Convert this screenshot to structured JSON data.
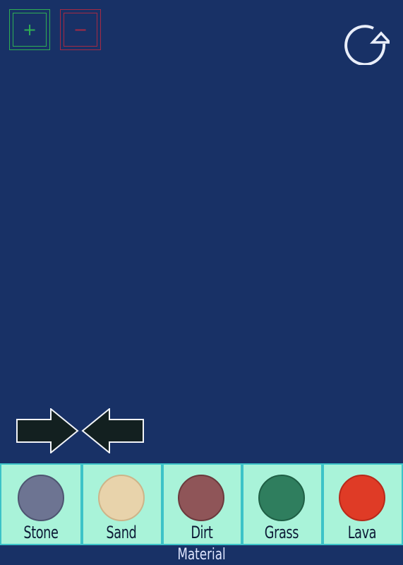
{
  "toolbar": {
    "zoom_in_symbol": "+",
    "zoom_out_symbol": "−",
    "zoom_in_color": "#2fae54",
    "zoom_out_color": "#a52a44",
    "reset_icon": "refresh-icon"
  },
  "controls": {
    "right_arrow_icon": "arrow-right-icon",
    "left_arrow_icon": "arrow-left-icon"
  },
  "materials": [
    {
      "label": "Stone",
      "color": "#6d7492"
    },
    {
      "label": "Sand",
      "color": "#e8d3ab"
    },
    {
      "label": "Dirt",
      "color": "#8f5558"
    },
    {
      "label": "Grass",
      "color": "#2f7e5e"
    },
    {
      "label": "Lava",
      "color": "#df3b26"
    }
  ],
  "palette": {
    "title": "Material",
    "background": "#a9f3d9",
    "border": "#3cc3c8"
  },
  "canvas": {
    "background": "#183166"
  }
}
